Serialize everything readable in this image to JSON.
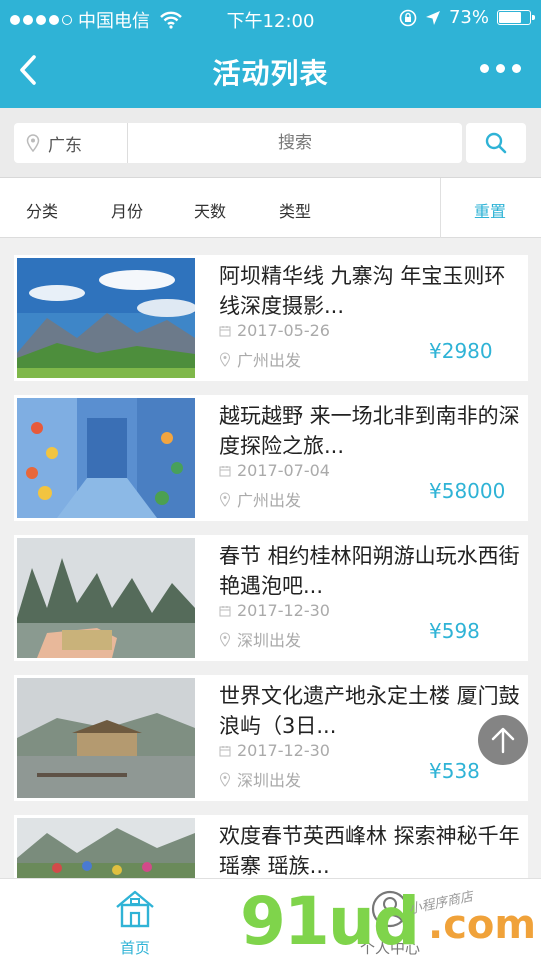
{
  "status_bar": {
    "carrier": "中国电信",
    "time": "下午12:00",
    "battery": "73%",
    "battery_level": 0.73
  },
  "nav": {
    "title": "活动列表",
    "back_icon": "chevron-left-icon",
    "more_icon": "more-dots-icon"
  },
  "search": {
    "region": "广东",
    "placeholder": "搜索",
    "button_icon": "search-icon"
  },
  "filters": {
    "items": [
      "分类",
      "月份",
      "天数",
      "类型"
    ],
    "reset": "重置"
  },
  "activities": [
    {
      "title": "阿坝精华线 九寨沟 年宝玉则环线深度摄影...",
      "date": "2017-05-26",
      "departure": "广州出发",
      "price": "¥2980"
    },
    {
      "title": "越玩越野 来一场北非到南非的深度探险之旅...",
      "date": "2017-07-04",
      "departure": "广州出发",
      "price": "¥58000"
    },
    {
      "title": "春节 相约桂林阳朔游山玩水西街艳遇泡吧...",
      "date": "2017-12-30",
      "departure": "深圳出发",
      "price": "¥598"
    },
    {
      "title": "世界文化遗产地永定土楼 厦门鼓浪屿（3日...",
      "date": "2017-12-30",
      "departure": "深圳出发",
      "price": "¥538"
    },
    {
      "title": "欢度春节英西峰林 探索神秘千年瑶寨 瑶族...",
      "date": "",
      "departure": "",
      "price": ""
    }
  ],
  "tabbar": {
    "home": "首页",
    "me": "个人中心"
  },
  "colors": {
    "accent": "#2fb3d6"
  },
  "watermark": {
    "brand": "91ud",
    "tld": ".com",
    "tagline": "小程序商店"
  }
}
